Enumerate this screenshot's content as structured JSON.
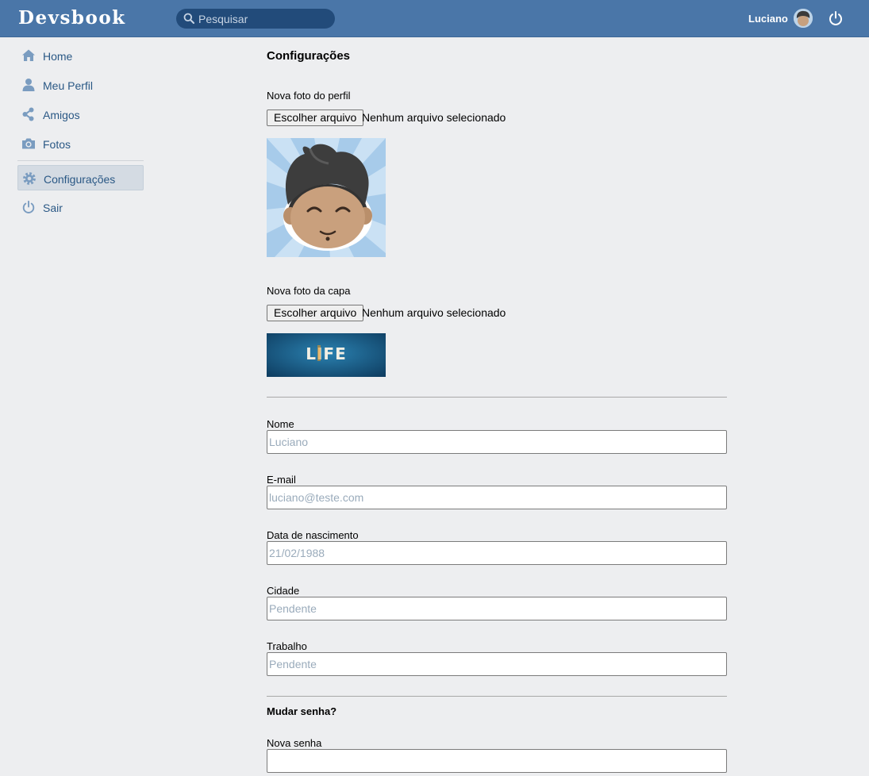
{
  "header": {
    "logo": "Devsbook",
    "search_placeholder": "Pesquisar",
    "user_name": "Luciano"
  },
  "sidebar": {
    "items": [
      {
        "label": "Home",
        "icon": "home-icon"
      },
      {
        "label": "Meu Perfil",
        "icon": "user-icon"
      },
      {
        "label": "Amigos",
        "icon": "share-icon"
      },
      {
        "label": "Fotos",
        "icon": "camera-icon"
      },
      {
        "label": "Configurações",
        "icon": "gear-icon",
        "active": true
      },
      {
        "label": "Sair",
        "icon": "power-icon"
      }
    ]
  },
  "main": {
    "title": "Configurações",
    "avatar_section": {
      "label": "Nova foto do perfil",
      "button": "Escolher arquivo",
      "status": "Nenhum arquivo selecionado"
    },
    "cover_section": {
      "label": "Nova foto da capa",
      "button": "Escolher arquivo",
      "status": "Nenhum arquivo selecionado",
      "cover_text": "LIFE"
    },
    "fields": {
      "name": {
        "label": "Nome",
        "placeholder": "Luciano"
      },
      "email": {
        "label": "E-mail",
        "placeholder": "luciano@teste.com"
      },
      "birthdate": {
        "label": "Data de nascimento",
        "placeholder": "21/02/1988"
      },
      "city": {
        "label": "Cidade",
        "placeholder": "Pendente"
      },
      "work": {
        "label": "Trabalho",
        "placeholder": "Pendente"
      }
    },
    "password_section": {
      "title": "Mudar senha?",
      "new_password_label": "Nova senha"
    }
  },
  "colors": {
    "header_bg": "#4a76a8",
    "search_bg": "#224b7a",
    "link": "#2a5885",
    "page_bg": "#edeef0",
    "icon": "#7a9cc0"
  }
}
